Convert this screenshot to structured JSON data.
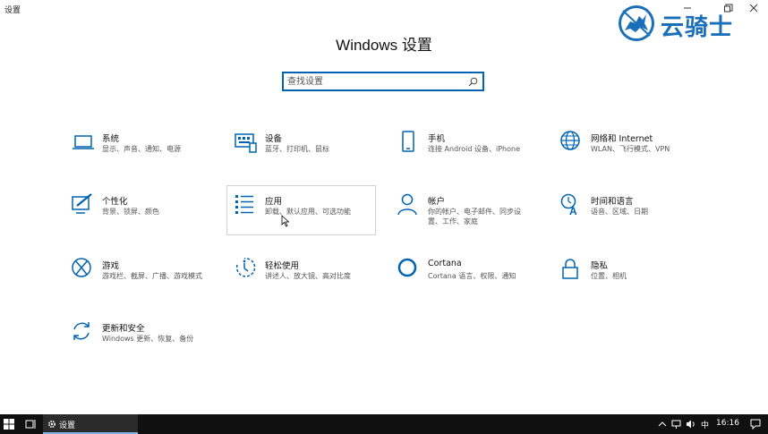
{
  "window": {
    "title": "设置"
  },
  "watermark": {
    "text": "云骑士"
  },
  "page": {
    "title": "Windows 设置"
  },
  "search": {
    "placeholder": "查找设置"
  },
  "tiles": [
    {
      "name": "系统",
      "desc": "显示、声音、通知、电源",
      "icon": "laptop-icon"
    },
    {
      "name": "设备",
      "desc": "蓝牙、打印机、鼠标",
      "icon": "keyboard-icon"
    },
    {
      "name": "手机",
      "desc": "连接 Android 设备、iPhone",
      "icon": "phone-icon"
    },
    {
      "name": "网络和 Internet",
      "desc": "WLAN、飞行模式、VPN",
      "icon": "globe-icon"
    },
    {
      "name": "个性化",
      "desc": "背景、锁屏、颜色",
      "icon": "paint-icon"
    },
    {
      "name": "应用",
      "desc": "卸载、默认应用、可选功能",
      "icon": "apps-list-icon"
    },
    {
      "name": "帐户",
      "desc": "你的帐户、电子邮件、同步设置、工作、家庭",
      "desc_lines": [
        "你的帐户、电子邮件、同步设",
        "置、工作、家庭"
      ],
      "icon": "person-icon"
    },
    {
      "name": "时间和语言",
      "desc": "语音、区域、日期",
      "icon": "time-language-icon"
    },
    {
      "name": "游戏",
      "desc": "游戏栏、截屏、广播、游戏模式",
      "icon": "xbox-icon"
    },
    {
      "name": "轻松使用",
      "desc": "讲述人、放大镜、高对比度",
      "icon": "ease-of-access-icon"
    },
    {
      "name": "Cortana",
      "desc": "Cortana 语言、权限、通知",
      "icon": "cortana-icon"
    },
    {
      "name": "隐私",
      "desc": "位置、相机",
      "icon": "lock-icon"
    },
    {
      "name": "更新和安全",
      "desc": "Windows 更新、恢复、备份",
      "icon": "sync-icon"
    }
  ],
  "taskbar": {
    "app_label": "设置",
    "ime": "中",
    "time": "16:16"
  },
  "colors": {
    "accent": "#0063b1",
    "taskbar": "#101010"
  }
}
